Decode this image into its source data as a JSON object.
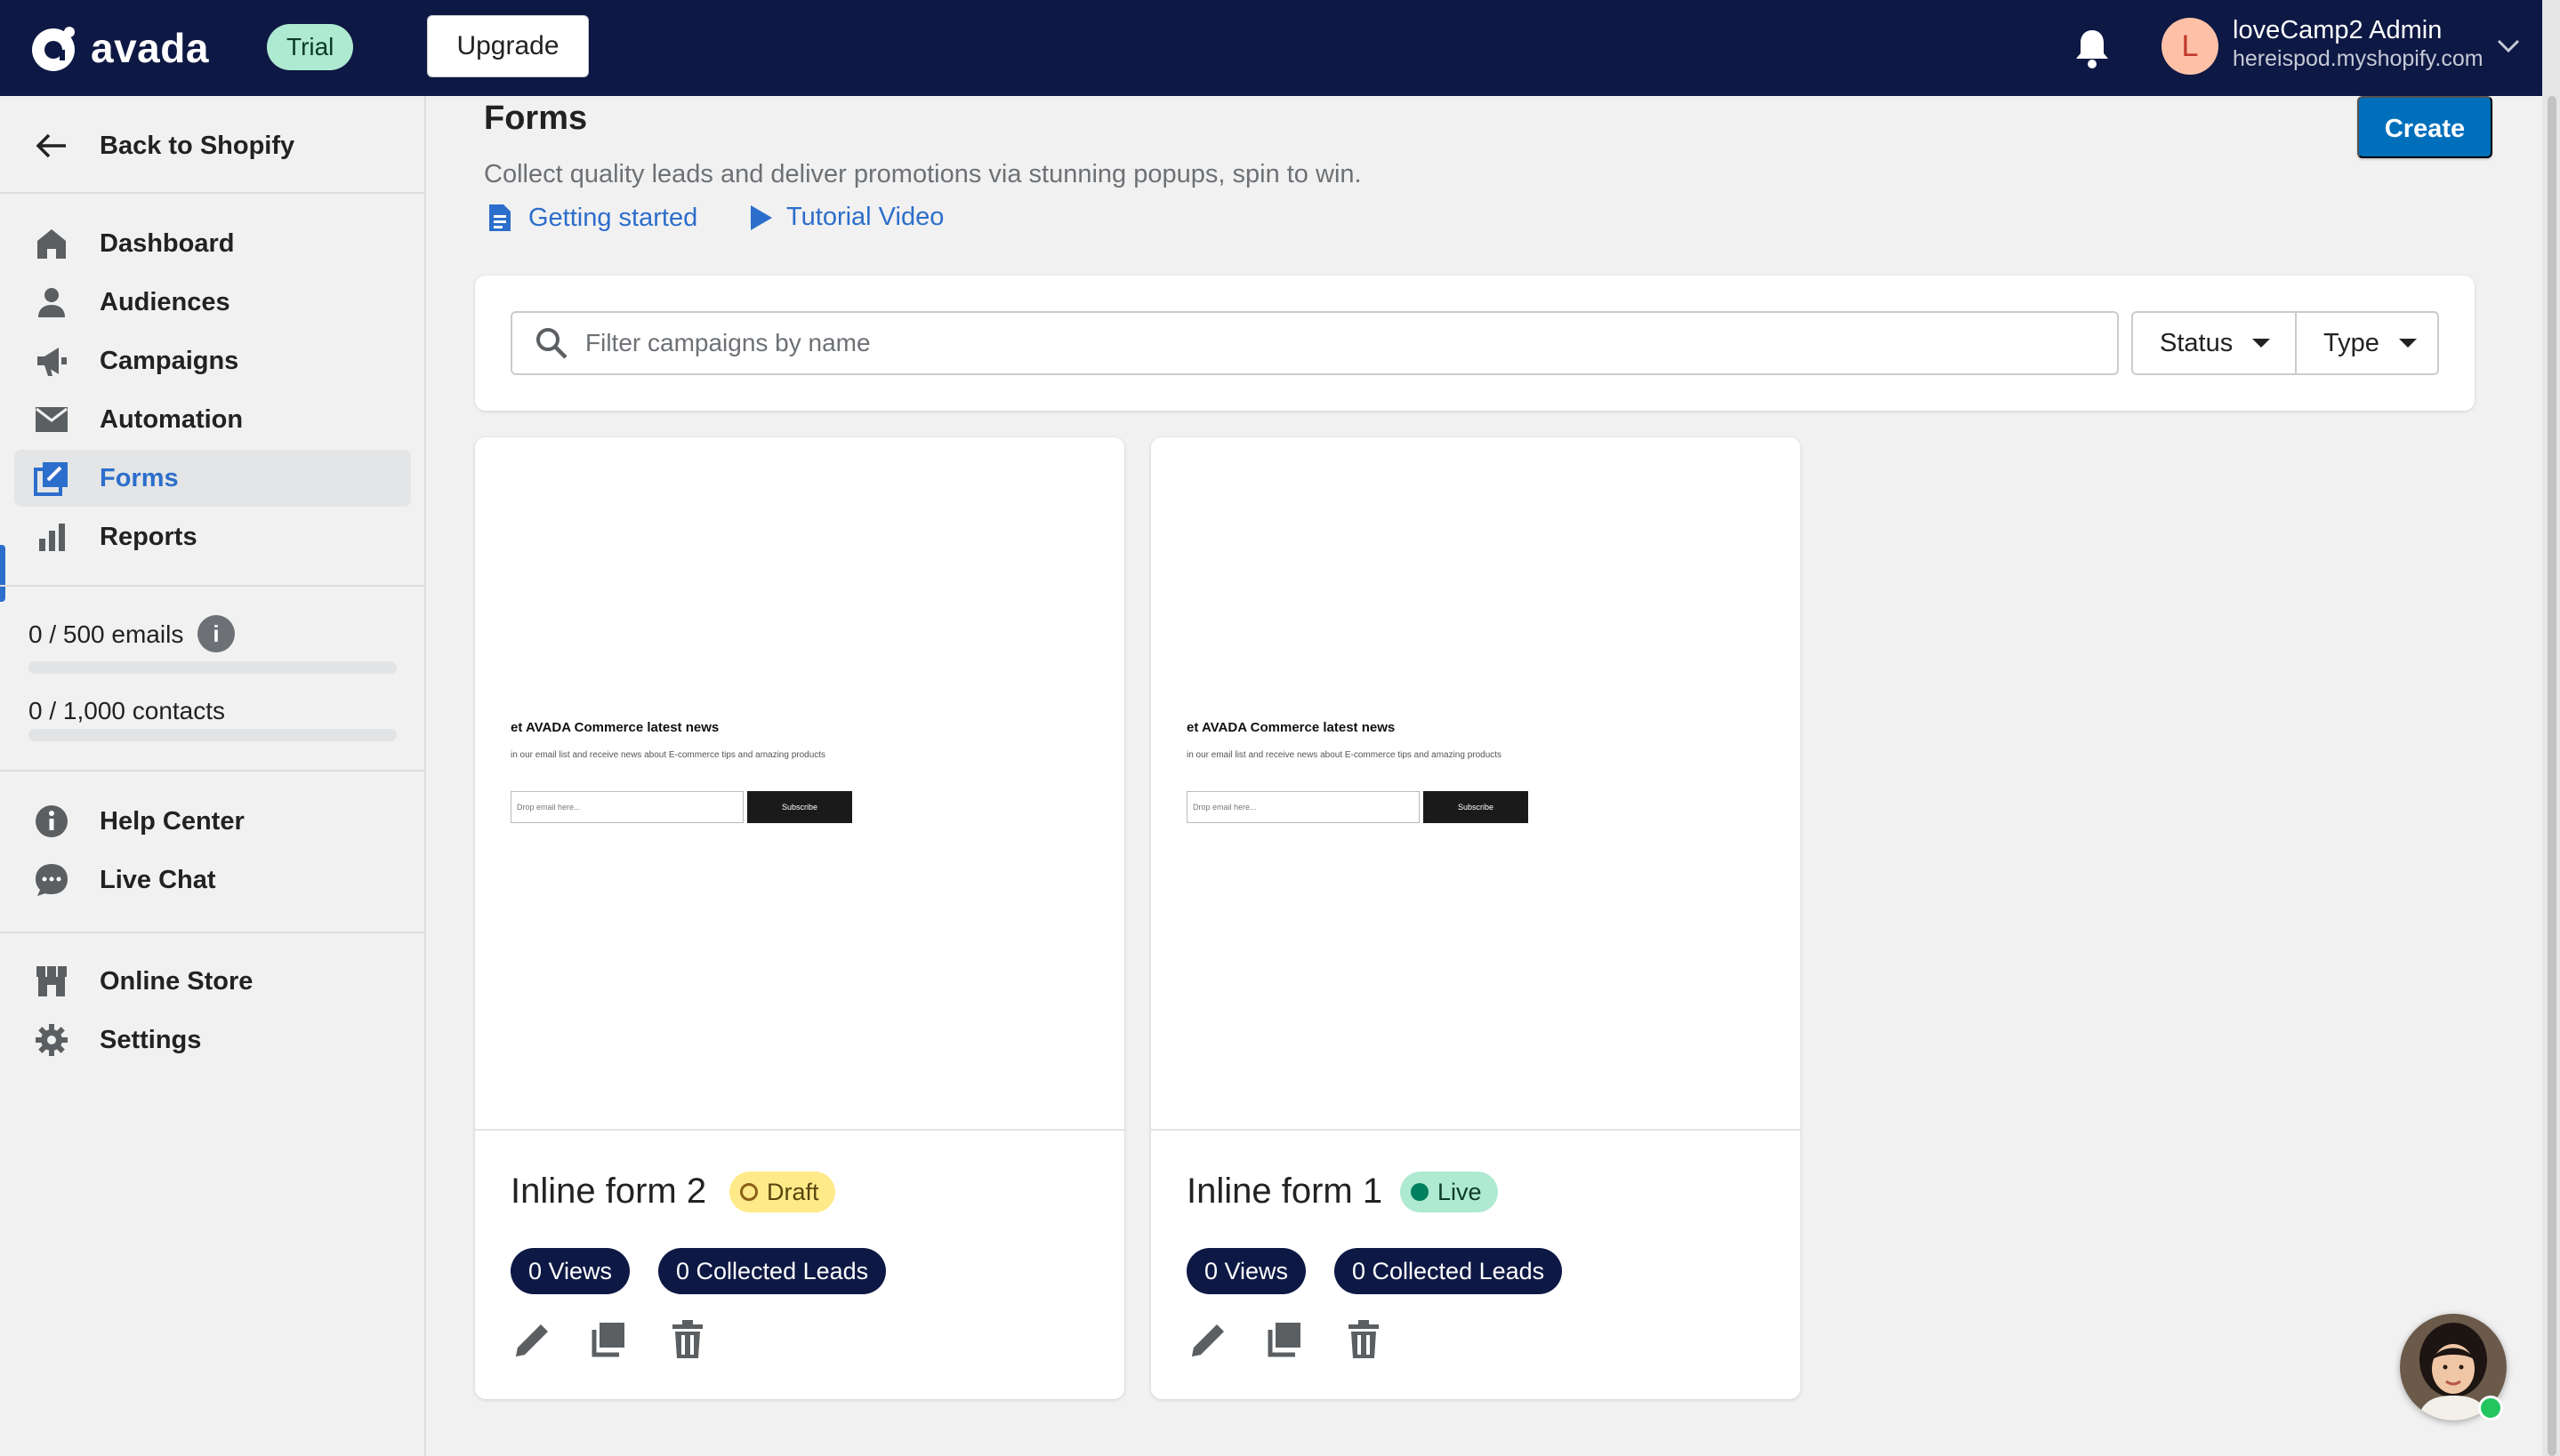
{
  "topbar": {
    "logo_text": "avada",
    "trial_label": "Trial",
    "upgrade_label": "Upgrade",
    "user_initial": "L",
    "user_name": "loveCamp2 Admin",
    "user_shop": "hereispod.myshopify.com",
    "brand_color": "#0e1844"
  },
  "sidebar": {
    "back_label": "Back to Shopify",
    "nav": [
      {
        "label": "Dashboard",
        "icon": "home-icon"
      },
      {
        "label": "Audiences",
        "icon": "person-icon"
      },
      {
        "label": "Campaigns",
        "icon": "megaphone-icon"
      },
      {
        "label": "Automation",
        "icon": "envelope-icon"
      },
      {
        "label": "Forms",
        "icon": "forms-icon",
        "active": true
      },
      {
        "label": "Reports",
        "icon": "bar-chart-icon"
      }
    ],
    "usage": {
      "emails_label": "0 / 500 emails",
      "emails_fraction": 0,
      "contacts_label": "0 / 1,000 contacts",
      "contacts_fraction": 0
    },
    "help": [
      {
        "label": "Help Center",
        "icon": "info-icon"
      },
      {
        "label": "Live Chat",
        "icon": "chat-icon"
      }
    ],
    "store": [
      {
        "label": "Online Store",
        "icon": "store-icon"
      },
      {
        "label": "Settings",
        "icon": "gear-icon"
      }
    ]
  },
  "main": {
    "title": "Forms",
    "subtitle": "Collect quality leads and deliver promotions via stunning popups, spin to win.",
    "getting_started": "Getting started",
    "tutorial_video": "Tutorial Video",
    "create_label": "Create",
    "search_placeholder": "Filter campaigns by name",
    "status_label": "Status",
    "type_label": "Type",
    "accent_color": "#006fbb"
  },
  "forms": [
    {
      "name": "Inline form 2",
      "status": "Draft",
      "views": "0 Views",
      "leads": "0 Collected Leads",
      "preview": {
        "title": "et AVADA Commerce latest news",
        "desc": "in our email list and receive news about E-commerce tips and amazing products",
        "placeholder": "Drop email here...",
        "button": "Subscribe"
      }
    },
    {
      "name": "Inline form 1",
      "status": "Live",
      "views": "0 Views",
      "leads": "0 Collected Leads",
      "preview": {
        "title": "et AVADA Commerce latest news",
        "desc": "in our email list and receive news about E-commerce tips and amazing products",
        "placeholder": "Drop email here...",
        "button": "Subscribe"
      }
    }
  ]
}
